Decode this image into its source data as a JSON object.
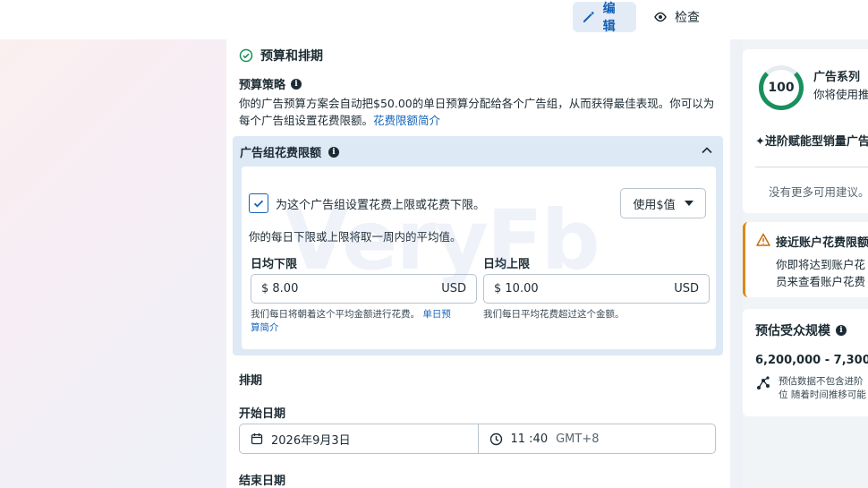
{
  "toolbar": {
    "edit_label": "编辑",
    "review_label": "检查"
  },
  "budget": {
    "section_title": "预算和排期",
    "strategy_label": "预算策略",
    "strategy_text": "你的广告预算方案会自动把$50.00的单日预算分配给各个广告组，从而获得最佳表现。你可以为每个广告组设置花费限额。",
    "strategy_link": "花费限额简介"
  },
  "limits": {
    "title": "广告组花费限额",
    "checkbox_label": "为这个广告组设置花费上限或花费下限。",
    "checkbox_checked": true,
    "use_button_label": "使用$值",
    "avg_note": "你的每日下限或上限将取一周内的平均值。",
    "min": {
      "label": "日均下限",
      "value": "$ 8.00",
      "currency": "USD",
      "help": "我们每日将朝着这个平均金额进行花费。",
      "help_link_1": "单日预",
      "help_link_2": "算简介"
    },
    "max": {
      "label": "日均上限",
      "value": "$ 10.00",
      "currency": "USD",
      "help": "我们每日平均花费超过这个金额。"
    }
  },
  "schedule": {
    "title": "排期",
    "start_label": "开始日期",
    "start_date": "2026年9月3日",
    "start_time": "11 :40",
    "timezone": "GMT+8",
    "end_label": "结束日期"
  },
  "right": {
    "score": "100",
    "score_title": "广告系列",
    "score_sub": "你将使用推",
    "advantage_item": "✦进阶赋能型销量广告",
    "no_more": "没有更多可用建议。",
    "warning_title": "接近账户花费限额",
    "warning_line1": "你即将达到账户花",
    "warning_line2": "员来查看账户花费",
    "audience_title": "预估受众规模",
    "audience_range": "6,200,000 - 7,300,0",
    "audience_note_1": "预估数据不包含进阶",
    "audience_note_2": "位 随着时间推移可能"
  },
  "watermark": "VeryFb",
  "colors": {
    "accent": "#1664b8",
    "success": "#1a8f5c",
    "warning": "#d88a15"
  }
}
